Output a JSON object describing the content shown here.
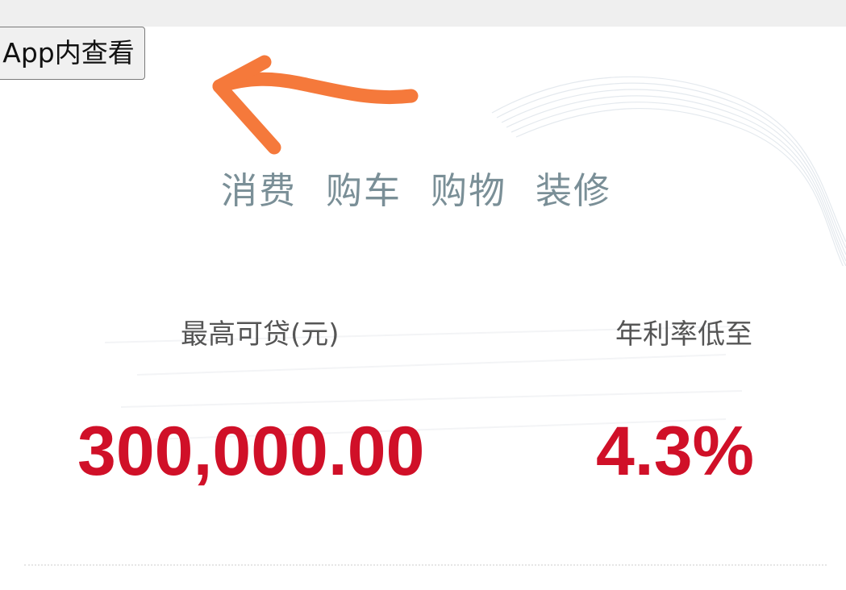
{
  "header": {
    "open_in_app_label": "App内查看"
  },
  "tags": [
    "消费",
    "购车",
    "购物",
    "装修"
  ],
  "loan": {
    "max_amount_label": "最高可贷(元)",
    "max_amount_value": "300,000.00",
    "rate_label": "年利率低至",
    "rate_value": "4.3%"
  },
  "colors": {
    "accent_red": "#d01028",
    "tag_gray_blue": "#7a8f97",
    "annotation_orange": "#f5793b"
  },
  "icons": {
    "annotation": "arrow-left-icon"
  }
}
